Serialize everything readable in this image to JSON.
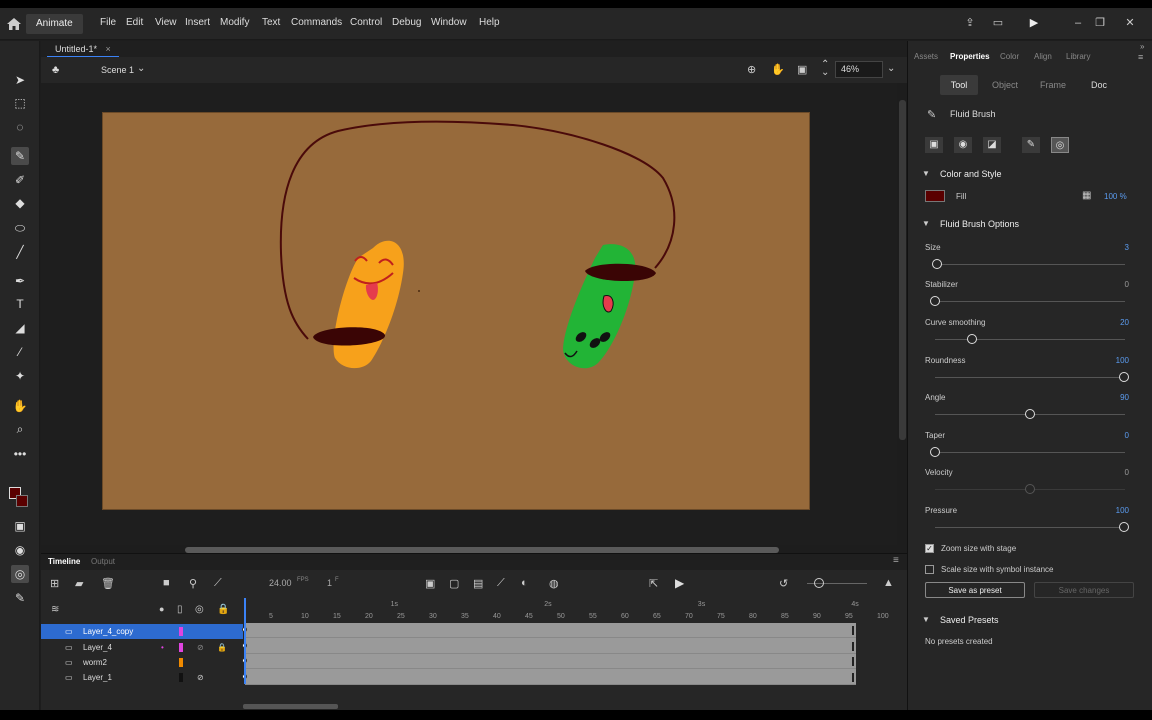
{
  "app": {
    "name": "Animate",
    "menus": [
      "File",
      "Edit",
      "View",
      "Insert",
      "Modify",
      "Text",
      "Commands",
      "Control",
      "Debug",
      "Window",
      "Help"
    ]
  },
  "document": {
    "tab_title": "Untitled-1*",
    "scene": "Scene 1",
    "zoom": "46%"
  },
  "timeline": {
    "tabs": [
      "Timeline",
      "Output"
    ],
    "fps": "24.00",
    "fps_unit": "FPS",
    "frame": "1",
    "frame_unit": "F",
    "ruler": [
      "5",
      "10",
      "15",
      "20",
      "25",
      "30",
      "35",
      "40",
      "45",
      "50",
      "55",
      "60",
      "65",
      "70",
      "75",
      "80",
      "85",
      "90",
      "95",
      "100"
    ],
    "seconds": [
      "1s",
      "2s",
      "3s",
      "4s"
    ],
    "layers": [
      {
        "name": "Layer_4_copy",
        "color": "#e044e0",
        "selected": true
      },
      {
        "name": "Layer_4",
        "color": "#e044e0",
        "selected": false
      },
      {
        "name": "worm2",
        "color": "#f08a00",
        "selected": false
      },
      {
        "name": "Layer_1",
        "color": "#111111",
        "selected": false
      }
    ]
  },
  "properties": {
    "panel_tabs": [
      "Assets",
      "Properties",
      "Color",
      "Align",
      "Library"
    ],
    "mode_tabs": [
      "Tool",
      "Object",
      "Frame",
      "Doc"
    ],
    "tool_name": "Fluid Brush",
    "color_style": {
      "title": "Color and Style",
      "fill_label": "Fill",
      "fill_color": "#5a0000",
      "alpha": "100 %"
    },
    "brush_options": {
      "title": "Fluid Brush Options",
      "size": {
        "label": "Size",
        "value": "3"
      },
      "stabilizer": {
        "label": "Stabilizer",
        "value": "0"
      },
      "curve_smoothing": {
        "label": "Curve smoothing",
        "value": "20"
      },
      "roundness": {
        "label": "Roundness",
        "value": "100"
      },
      "angle": {
        "label": "Angle",
        "value": "90"
      },
      "taper": {
        "label": "Taper",
        "value": "0"
      },
      "velocity": {
        "label": "Velocity",
        "value": "0"
      },
      "pressure": {
        "label": "Pressure",
        "value": "100"
      }
    },
    "zoom_size_label": "Zoom size with stage",
    "scale_size_label": "Scale size with symbol instance",
    "save_preset": "Save as preset",
    "save_changes": "Save changes",
    "saved_presets_title": "Saved Presets",
    "no_presets": "No presets created"
  },
  "colors": {
    "stage_bg": "#976a3b",
    "accent": "#3b82f6",
    "stroke_color": "#5a0000"
  }
}
